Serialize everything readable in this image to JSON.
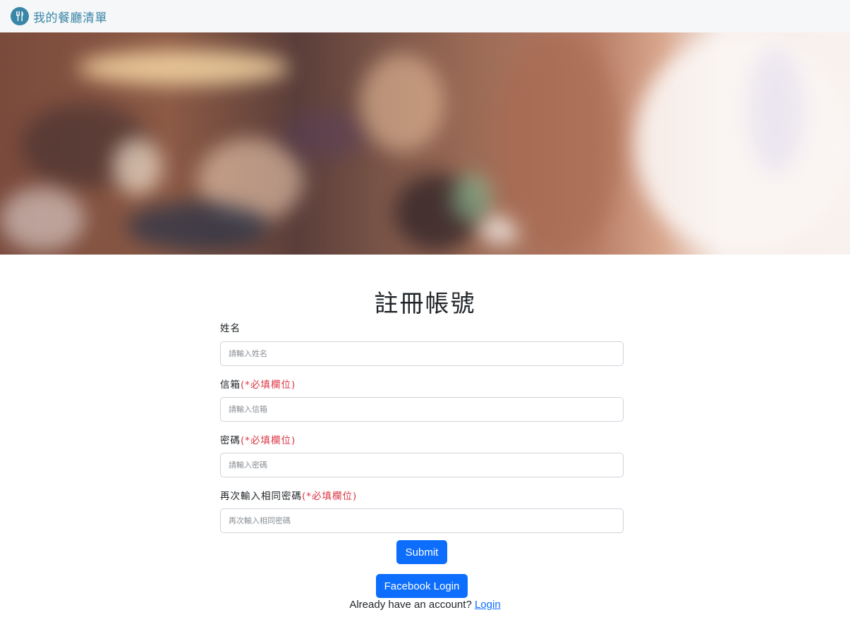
{
  "navbar": {
    "brand": "我的餐廳清單",
    "brand_color": "#3a86a7"
  },
  "page": {
    "title": "註冊帳號"
  },
  "form": {
    "required_note": "(*必填欄位)",
    "name": {
      "label": "姓名",
      "placeholder": "請輸入姓名",
      "value": ""
    },
    "email": {
      "label": "信箱",
      "placeholder": "請輸入信箱",
      "value": ""
    },
    "password": {
      "label": "密碼",
      "placeholder": "請輸入密碼",
      "value": ""
    },
    "confirm": {
      "label": "再次輸入相同密碼",
      "placeholder": "再次輸入相同密碼",
      "value": ""
    },
    "submit_label": "Submit",
    "facebook_label": "Facebook Login"
  },
  "footer": {
    "prompt": "Already have an account?",
    "login_link": "Login"
  },
  "colors": {
    "primary": "#0d6efd",
    "required": "#dc3545"
  },
  "icons": {
    "brand_logo": "utensils-icon"
  }
}
